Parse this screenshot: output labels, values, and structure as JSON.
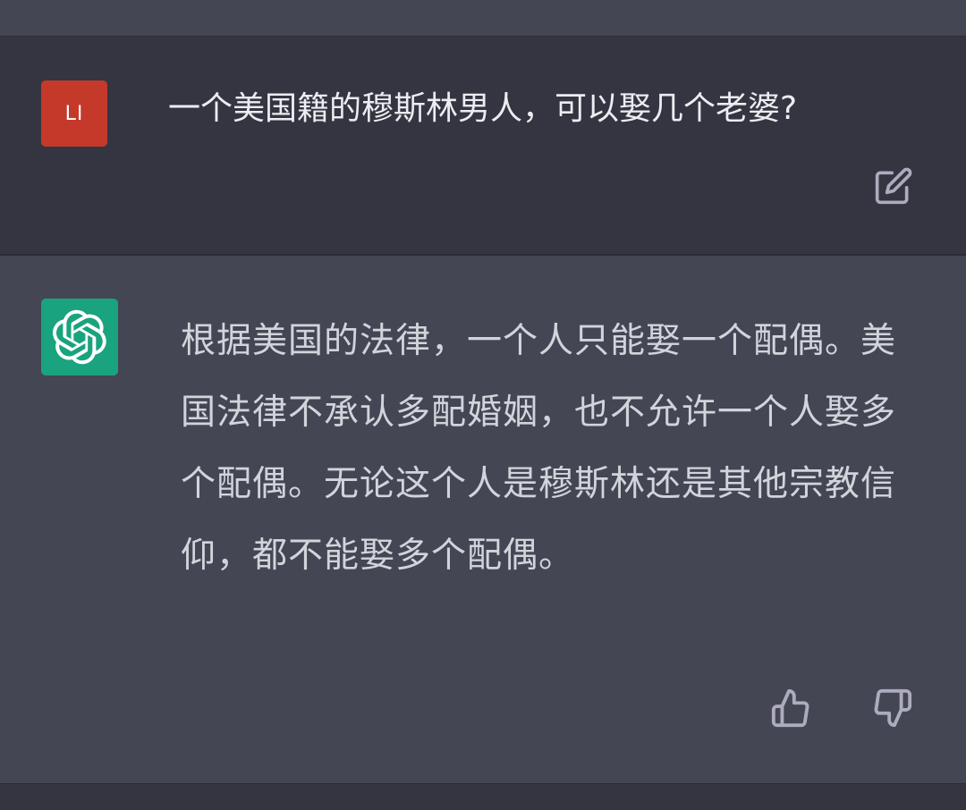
{
  "colors": {
    "user_avatar_bg": "#c5392a",
    "assistant_avatar_bg": "#19a37f",
    "icon_stroke": "#acacbe"
  },
  "user_message": {
    "avatar_initials": "LI",
    "text": "一个美国籍的穆斯林男人，可以娶几个老婆?",
    "edit_icon": "edit-icon"
  },
  "assistant_message": {
    "avatar_icon": "openai-logo-icon",
    "text": "根据美国的法律，一个人只能娶一个配偶。美国法律不承认多配婚姻，也不允许一个人娶多个配偶。无论这个人是穆斯林还是其他宗教信仰，都不能娶多个配偶。",
    "thumbs_up_icon": "thumbs-up-icon",
    "thumbs_down_icon": "thumbs-down-icon"
  }
}
